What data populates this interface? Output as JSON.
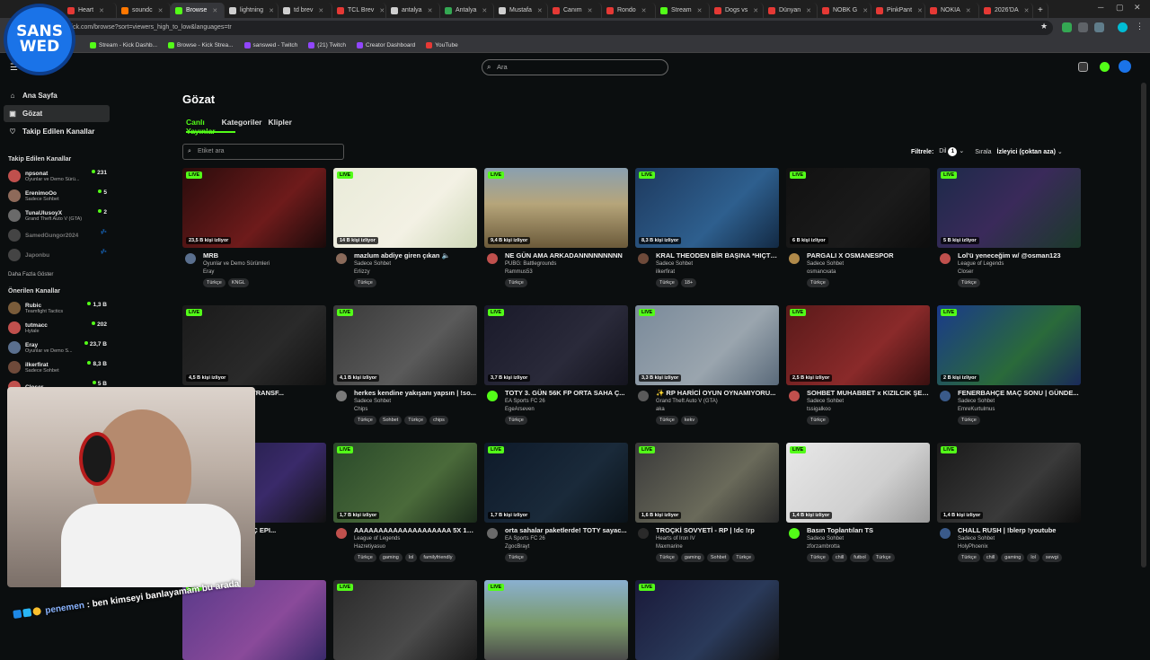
{
  "browser": {
    "tabs": [
      {
        "label": "Heart",
        "color": "#e53935",
        "w": 60
      },
      {
        "label": "soundc",
        "color": "#ff7700",
        "w": 60
      },
      {
        "label": "Browse",
        "color": "#53fc18",
        "w": 60,
        "active": true
      },
      {
        "label": "lightning",
        "color": "#cfcfcf",
        "w": 60
      },
      {
        "label": "td brev",
        "color": "#cfcfcf",
        "w": 60
      },
      {
        "label": "TCL Brev",
        "color": "#e53935",
        "w": 60
      },
      {
        "label": "antalya",
        "color": "#cfcfcf",
        "w": 60
      },
      {
        "label": "Antalya",
        "color": "#34a853",
        "w": 60
      },
      {
        "label": "Mustafa",
        "color": "#cfcfcf",
        "w": 60
      },
      {
        "label": "Canım",
        "color": "#e53935",
        "w": 60
      },
      {
        "label": "Rondo",
        "color": "#e53935",
        "w": 60
      },
      {
        "label": "Stream",
        "color": "#53fc18",
        "w": 60
      },
      {
        "label": "Dogs vs",
        "color": "#e53935",
        "w": 60
      },
      {
        "label": "Dünyan",
        "color": "#e53935",
        "w": 60
      },
      {
        "label": "NOBK G",
        "color": "#e53935",
        "w": 60
      },
      {
        "label": "PinkPant",
        "color": "#e53935",
        "w": 60
      },
      {
        "label": "NOKIA",
        "color": "#e53935",
        "w": 60
      },
      {
        "label": "2026'DA",
        "color": "#e53935",
        "w": 60
      }
    ],
    "new_tab": "+",
    "url": "kick.com/browse?sort=viewers_high_to_low&languages=tr",
    "bookmarks": [
      {
        "label": "Stream - Kick Dashb...",
        "color": "#53fc18"
      },
      {
        "label": "Browse - Kick Strea...",
        "color": "#53fc18"
      },
      {
        "label": "sanswed - Twitch",
        "color": "#9146ff"
      },
      {
        "label": "(21) Twitch",
        "color": "#9146ff"
      },
      {
        "label": "Creator Dashboard",
        "color": "#9146ff"
      },
      {
        "label": "YouTube",
        "color": "#e53935"
      }
    ]
  },
  "overlay": {
    "logo_line1": "SANS",
    "logo_line2": "WED",
    "chat_user": "penemen",
    "chat_message": ": ben kimseyi banlayamam bu arada"
  },
  "header": {
    "search_placeholder": "Ara"
  },
  "sidebar": {
    "nav": [
      {
        "label": "Ana Sayfa",
        "icon": "home-icon",
        "glyph": "⌂"
      },
      {
        "label": "Gözat",
        "icon": "browse-icon",
        "glyph": "▣",
        "active": true
      },
      {
        "label": "Takip Edilen Kanallar",
        "icon": "heart-icon",
        "glyph": "♡"
      }
    ],
    "followed_header": "Takip Edilen Kanallar",
    "followed": [
      {
        "name": "npsonat",
        "game": "Oyunlar ve Demo Sürü...",
        "viewers": "231",
        "color": "#c0504d"
      },
      {
        "name": "ErenimoOo",
        "game": "Sadece Sohbet",
        "viewers": "5",
        "color": "#8e6a5a"
      },
      {
        "name": "TunaUlusoyX",
        "game": "Grand Theft Auto V (GTA)",
        "viewers": "2",
        "color": "#6a6a6a"
      },
      {
        "name": "SamedGungor2024",
        "game": "",
        "viewers": "",
        "color": "#444",
        "offline": true
      },
      {
        "name": "Japonbu",
        "game": "",
        "viewers": "",
        "color": "#444",
        "offline": true
      }
    ],
    "more_label": "Daha Fazla Göster",
    "recommended_header": "Önerilen Kanallar",
    "recommended": [
      {
        "name": "Rubic",
        "game": "Teamfight Tactics",
        "viewers": "1,3 B",
        "color": "#7a5c3a"
      },
      {
        "name": "tutmacc",
        "game": "Hytale",
        "viewers": "202",
        "color": "#c0504d"
      },
      {
        "name": "Eray",
        "game": "Oyunlar ve Demo S...",
        "viewers": "23,7 B",
        "color": "#5a6f8e"
      },
      {
        "name": "ilkerfirat",
        "game": "Sadece Sohbet",
        "viewers": "8,3 B",
        "color": "#6e4a3a"
      },
      {
        "name": "Closer",
        "game": "",
        "viewers": "5 B",
        "color": "#c0504d"
      }
    ]
  },
  "main": {
    "title": "Gözat",
    "tabs": [
      {
        "label": "Canlı Yayınlar",
        "active": true
      },
      {
        "label": "Kategoriler"
      },
      {
        "label": "Klipler"
      }
    ],
    "tag_search_placeholder": "Etiket ara",
    "filter_label": "Filtrele:",
    "lang_label": "Dil",
    "lang_count": "1",
    "sort_label": "Sırala",
    "sort_value": "İzleyici (çoktan aza)",
    "live_label": "LIVE"
  },
  "streams": [
    {
      "title": "MRB",
      "game": "Oyunlar ve Demo Sürümleri",
      "user": "Eray",
      "views": "23,5 B kişi izliyor",
      "tags": [
        "Türkçe",
        "KNGL"
      ],
      "bg": "linear-gradient(135deg,#2a0c0c,#6e1b1b 60%,#1a0a0a)",
      "av": "#5a6f8e"
    },
    {
      "title": "mazlum abdiye giren çıkan 🔈",
      "game": "Sadece Sohbet",
      "user": "Erlizzy",
      "views": "14 B kişi izliyor",
      "tags": [
        "Türkçe"
      ],
      "bg": "linear-gradient(135deg,#e9ebd9,#f3f1e4 60%,#cfd8b8)",
      "av": "#8a6a5a"
    },
    {
      "title": "NE GÜN AMA ARKADANNNNNNNNN",
      "game": "PUBG: Battlegrounds",
      "user": "Rammus53",
      "views": "9,4 B kişi izliyor",
      "tags": [
        "Türkçe"
      ],
      "bg": "linear-gradient(180deg,#8aa0b0 0%,#b6a57a 45%,#6b5a3a 100%)",
      "av": "#c0504d"
    },
    {
      "title": "KRAL THEODEN BİR BAŞINA *HIÇTE...",
      "game": "Sadece Sohbet",
      "user": "ilkerfirat",
      "views": "8,3 B kişi izliyor",
      "tags": [
        "Türkçe",
        "18+"
      ],
      "bg": "linear-gradient(135deg,#1e3a5f,#2e5f8e 60%,#132a44)",
      "av": "#6e4a3a"
    },
    {
      "title": "PARGALI X OSMANESPOR",
      "game": "Sadece Sohbet",
      "user": "osmancxata",
      "views": "6 B kişi izliyor",
      "tags": [
        "Türkçe"
      ],
      "bg": "linear-gradient(135deg,#111,#1b1b1b 60%,#0d0d0d)",
      "av": "#b08a4a"
    },
    {
      "title": "Lol'ü yeneceğim w/ @osman123",
      "game": "League of Legends",
      "user": "Closer",
      "views": "5 B kişi izliyor",
      "tags": [
        "Türkçe"
      ],
      "bg": "linear-gradient(135deg,#1d2a4a,#3a2a5a 50%,#1b3a2a)",
      "av": "#c0504d"
    },
    {
      "title": "FENERBAHÇE TRANSF...",
      "game": "",
      "user": "",
      "views": "4,5 B kişi izliyor",
      "tags": [],
      "bg": "linear-gradient(135deg,#1a1a1a,#2a2a2a 60%,#111)",
      "av": "#444"
    },
    {
      "title": "herkes kendine yakışanı yapsın | !so...",
      "game": "Sadece Sohbet",
      "user": "Chips",
      "views": "4,1 B kişi izliyor",
      "tags": [
        "Türkçe",
        "Sohbet",
        "Türkçe",
        "chips"
      ],
      "bg": "linear-gradient(135deg,#3a3a3a,#5a5a5a 60%,#2a2a2a)",
      "av": "#7a7a7a"
    },
    {
      "title": "TOTY 3. GÜN 56K FP ORTA SAHA Ç...",
      "game": "EA Sports FC 26",
      "user": "EgeArseven",
      "views": "3,7 B kişi izliyor",
      "tags": [
        "Türkçe"
      ],
      "bg": "linear-gradient(135deg,#1a1a2a,#2a2a3a 60%,#14141e)",
      "av": "#53fc18"
    },
    {
      "title": "✨ RP HARİCİ OYUN OYNAMIYORU...",
      "game": "Grand Theft Auto V (GTA)",
      "user": "aka",
      "views": "3,3 B kişi izliyor",
      "tags": [
        "Türkçe",
        "kekv"
      ],
      "bg": "linear-gradient(135deg,#7a8a9a,#9aa5ae 60%,#5a6a7a)",
      "av": "#5a5a5a"
    },
    {
      "title": "SOHBET MUHABBET x KIZILCIK ŞER...",
      "game": "Sadece Sohbet",
      "user": "tssigalkoo",
      "views": "2,5 B kişi izliyor",
      "tags": [
        "Türkçe"
      ],
      "bg": "linear-gradient(135deg,#5a1a1a,#8a2a2a 60%,#3a1010)",
      "av": "#c0504d"
    },
    {
      "title": "FENERBAHÇE MAÇ SONU | GÜNDE...",
      "game": "Sadece Sohbet",
      "user": "EmreKurtulmus",
      "views": "2 B kişi izliyor",
      "tags": [
        "Türkçe"
      ],
      "bg": "linear-gradient(135deg,#1a3a8a,#2a6a3a 60%,#1a2a5a)",
      "av": "#3a5a8a"
    },
    {
      "title": "...CİRİNDEN KAÇ EPI...",
      "game": "",
      "user": "",
      "views": "",
      "tags": [],
      "bg": "linear-gradient(135deg,#1a1a3a,#3a2a6a 60%,#111)",
      "av": "#444"
    },
    {
      "title": "AAAAAAAAAAAAAAAAAAAA 5X 1000...",
      "game": "League of Legends",
      "user": "Hazretiyasuo",
      "views": "1,7 B kişi izliyor",
      "tags": [
        "Türkçe",
        "gaming",
        "lol",
        "familyfriendly"
      ],
      "bg": "linear-gradient(135deg,#2a4a2a,#4a6a3a 60%,#1a2a1a)",
      "av": "#c0504d"
    },
    {
      "title": "orta sahalar paketlerde! TOTY sayac...",
      "game": "EA Sports FC 26",
      "user": "ZgocBrayt",
      "views": "1,7 B kişi izliyor",
      "tags": [
        "Türkçe"
      ],
      "bg": "linear-gradient(135deg,#0e1a2a,#1a2a3a 60%,#0a1218)",
      "av": "#6a6a6a"
    },
    {
      "title": "TROÇKİ SOVYETİ - RP | !dc !rp",
      "game": "Hearts of Iron IV",
      "user": "Maxmarine",
      "views": "1,6 B kişi izliyor",
      "tags": [
        "Türkçe",
        "gaming",
        "Sohbet",
        "Türkçe"
      ],
      "bg": "linear-gradient(135deg,#3a3a3a,#6a6a5a 60%,#2a2a2a)",
      "av": "#2a2a2a"
    },
    {
      "title": "Basın Toplantıları TS",
      "game": "Sadece Sohbet",
      "user": "zforzambrotta",
      "views": "1,4 B kişi izliyor",
      "tags": [
        "Türkçe",
        "chill",
        "futbol",
        "Türkçe"
      ],
      "bg": "linear-gradient(135deg,#e8e8e8,#cfcfcf 60%,#9a9a9a)",
      "av": "#53fc18"
    },
    {
      "title": "CHALL RUSH | !blerp !youtube",
      "game": "Sadece Sohbet",
      "user": "HolyPhoenix",
      "views": "1,4 B kişi izliyor",
      "tags": [
        "Türkçe",
        "chill",
        "gaming",
        "lol",
        "sewgi"
      ],
      "bg": "linear-gradient(135deg,#1a1a1a,#3a3a3a 60%,#0d0d0d)",
      "av": "#3a5a8a"
    },
    {
      "title": "",
      "game": "",
      "user": "",
      "views": "",
      "tags": [],
      "bg": "linear-gradient(135deg,#5a3a8a,#8a4a9a 60%,#3a2a6a)",
      "av": "#444"
    },
    {
      "title": "",
      "game": "",
      "user": "",
      "views": "",
      "tags": [],
      "bg": "linear-gradient(135deg,#2a2a2a,#4a4a4a 60%,#1a1a1a)",
      "av": "#444"
    },
    {
      "title": "",
      "game": "",
      "user": "",
      "views": "",
      "tags": [],
      "bg": "linear-gradient(180deg,#8ab0d0 0%,#7a9a6a 55%,#4a4a4a 100%)",
      "av": "#444"
    },
    {
      "title": "",
      "game": "",
      "user": "",
      "views": "",
      "tags": [],
      "bg": "linear-gradient(135deg,#1a1a3a,#2a3a5a 60%,#111)",
      "av": "#444"
    }
  ],
  "accent": "#53fc18"
}
